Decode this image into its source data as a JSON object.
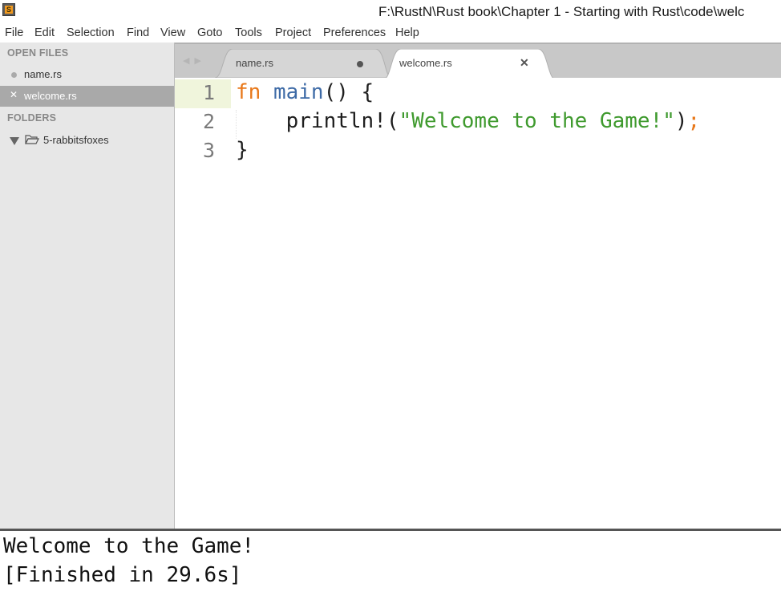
{
  "window": {
    "title": "F:\\RustN\\Rust book\\Chapter 1 - Starting with Rust\\code\\welc",
    "app_icon_letter": "S"
  },
  "menu": [
    "File",
    "Edit",
    "Selection",
    "Find",
    "View",
    "Goto",
    "Tools",
    "Project",
    "Preferences",
    "Help"
  ],
  "sidebar": {
    "open_files_header": "OPEN FILES",
    "open_files": [
      {
        "label": "name.rs",
        "active": false
      },
      {
        "label": "welcome.rs",
        "active": true
      }
    ],
    "folders_header": "FOLDERS",
    "folder": {
      "label": "5-rabbitsfoxes",
      "expanded": true
    }
  },
  "tabs": [
    {
      "label": "name.rs",
      "modified": true,
      "active": false
    },
    {
      "label": "welcome.rs",
      "modified": false,
      "active": true
    }
  ],
  "editor": {
    "line_numbers": [
      "1",
      "2",
      "3"
    ],
    "lines": [
      {
        "kw": "fn",
        "fn_name": "main",
        "rest": "() {"
      },
      {
        "indent": "    ",
        "macro": "println!(",
        "string": "\"Welcome to the Game!\"",
        "close": ")",
        "semi": ";"
      },
      {
        "text": "}"
      }
    ]
  },
  "output": {
    "lines": [
      "Welcome to the Game!",
      "[Finished in 29.6s]"
    ]
  },
  "colors": {
    "keyword": "#e8781a",
    "function": "#3d6aa6",
    "string": "#3f9a2e",
    "sidebar_bg": "#e7e7e7",
    "tabbar_bg": "#c8c8c8",
    "active_file_bg": "#a9a9a9"
  }
}
